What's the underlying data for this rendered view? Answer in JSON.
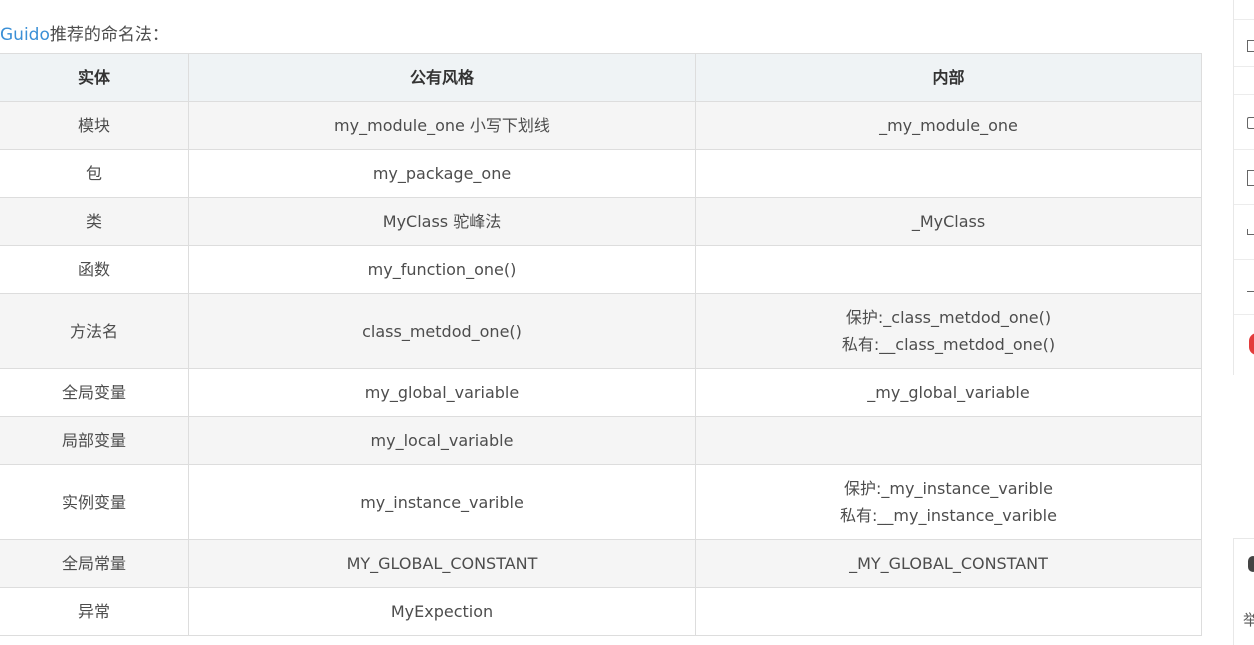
{
  "intro": {
    "link_text": "Guido",
    "text": "推荐的命名法："
  },
  "table": {
    "headers": [
      "实体",
      "公有风格",
      "内部"
    ],
    "rows": [
      {
        "entity": "模块",
        "public": "my_module_one 小写下划线",
        "internal": [
          "_my_module_one"
        ]
      },
      {
        "entity": "包",
        "public": "my_package_one",
        "internal": []
      },
      {
        "entity": "类",
        "public": "MyClass 驼峰法",
        "internal": [
          "_MyClass"
        ]
      },
      {
        "entity": "函数",
        "public": "my_function_one()",
        "internal": []
      },
      {
        "entity": "方法名",
        "public": "class_metdod_one()",
        "internal": [
          "保护:_class_metdod_one()",
          "私有:__class_metdod_one()"
        ]
      },
      {
        "entity": "全局变量",
        "public": "my_global_variable",
        "internal": [
          "_my_global_variable"
        ]
      },
      {
        "entity": "局部变量",
        "public": "my_local_variable",
        "internal": []
      },
      {
        "entity": "实例变量",
        "public": "my_instance_varible",
        "internal": [
          "保护:_my_instance_varible",
          "私有:__my_instance_varible"
        ]
      },
      {
        "entity": "全局常量",
        "public": "MY_GLOBAL_CONSTANT",
        "internal": [
          "_MY_GLOBAL_CONSTANT"
        ]
      },
      {
        "entity": "异常",
        "public": "MyExpection",
        "internal": []
      }
    ]
  },
  "sidebar": {
    "icons": [
      "edit-icon",
      "checkbox-icon",
      "star-icon",
      "bookmark-icon",
      "share-icon",
      "collapse-icon",
      "notification-badge"
    ],
    "report_label": "举"
  },
  "colors": {
    "link": "#3a8fd6",
    "header_bg": "#eff3f5",
    "stripe_bg": "#f5f5f5",
    "border": "#dddddd",
    "badge": "#e33c3c"
  }
}
